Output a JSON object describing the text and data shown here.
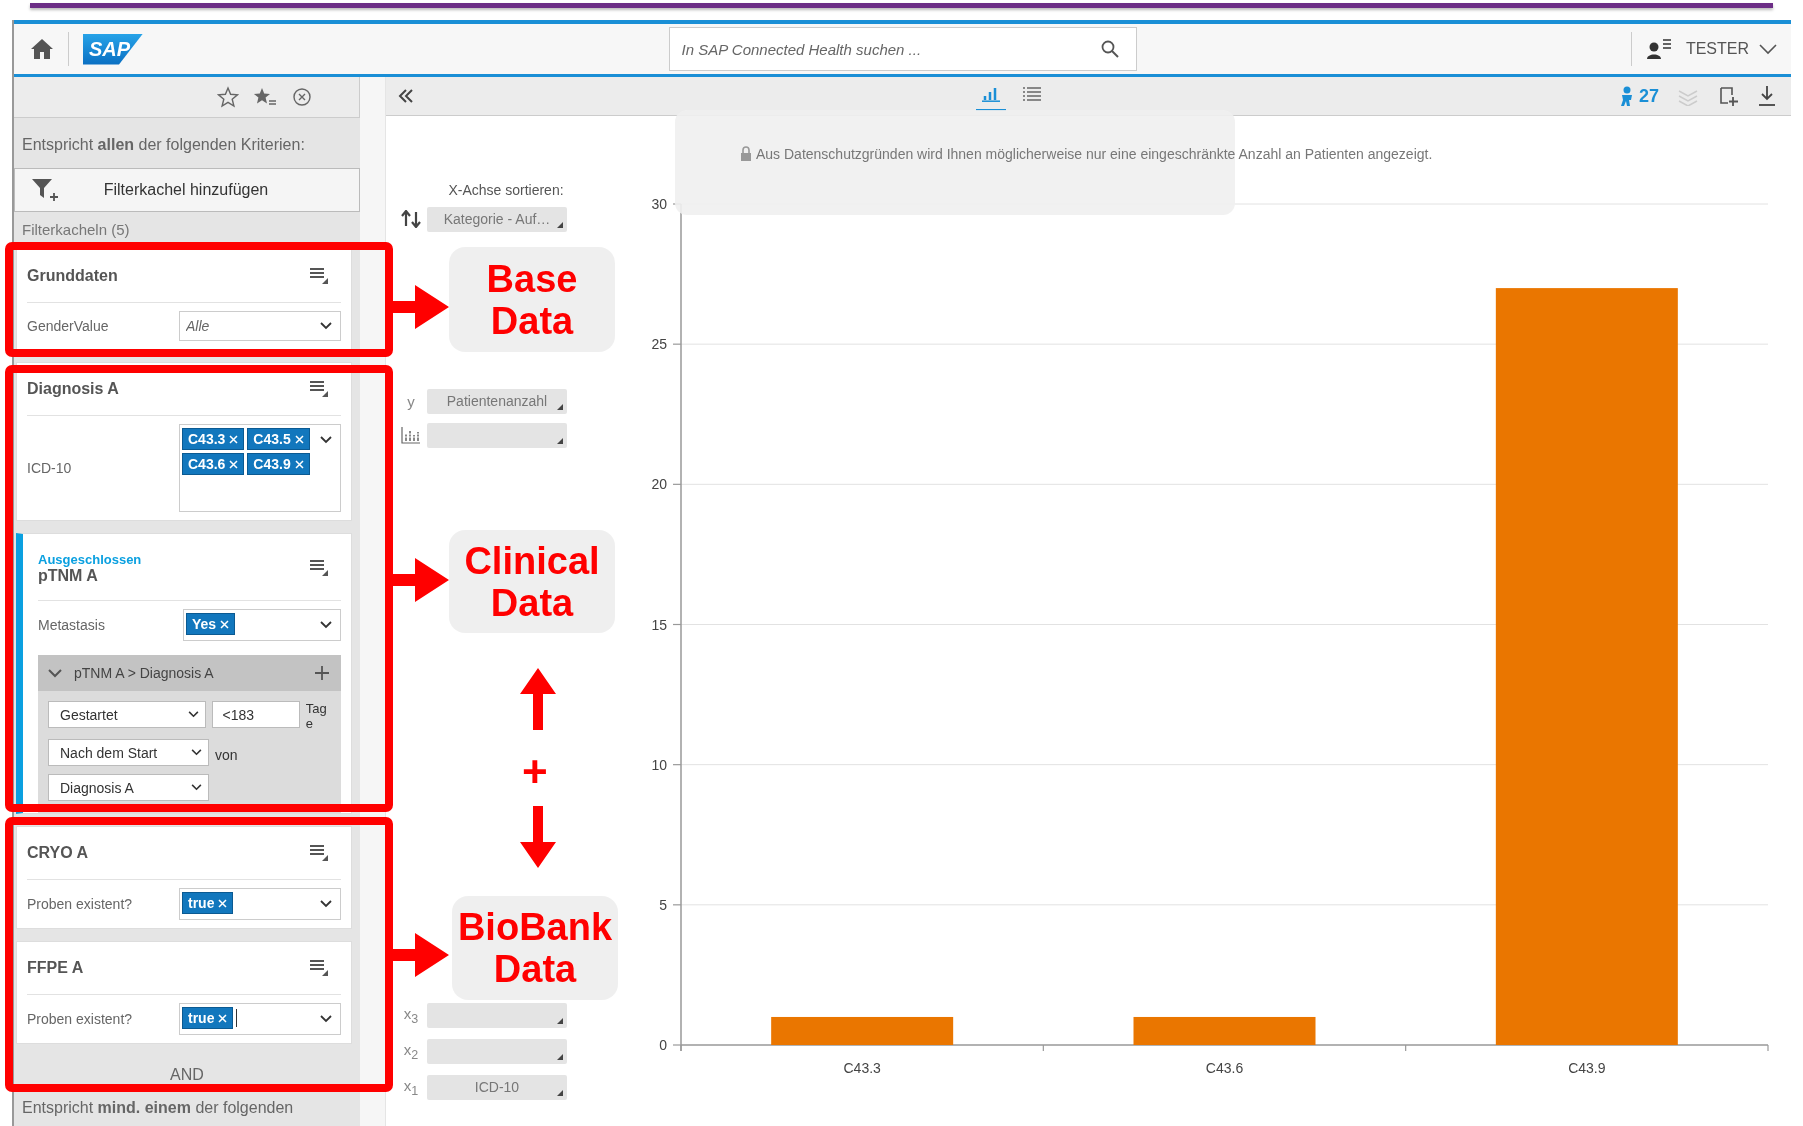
{
  "header": {
    "logo": "SAP",
    "search_placeholder": "In SAP Connected Health suchen ...",
    "user": "TESTER"
  },
  "filter_panel": {
    "match_all": "Entspricht **allen** der folgenden Kriterien:",
    "add_button": "Filterkachel hinzufügen",
    "count_label": "Filterkacheln (5)",
    "cards": [
      {
        "title": "Grunddaten",
        "excluded": false,
        "fields": [
          {
            "label": "GenderValue",
            "kind": "select",
            "placeholder": "Alle"
          }
        ]
      },
      {
        "title": "Diagnosis A",
        "excluded": false,
        "fields": [
          {
            "label": "ICD-10",
            "kind": "tags",
            "tags": [
              "C43.3",
              "C43.5",
              "C43.6",
              "C43.9"
            ],
            "focused": false
          }
        ]
      },
      {
        "title": "pTNM A",
        "excluded": true,
        "excluded_label": "Ausgeschlossen",
        "fields": [
          {
            "label": "Metastasis",
            "kind": "tags",
            "tags": [
              "Yes"
            ],
            "focused": false
          }
        ],
        "relation": {
          "title": "pTNM A > Diagnosis A",
          "expanded": true,
          "timing": "Gestartet",
          "days": "<183",
          "days_unit": "Tage",
          "anchor": "Nach dem Start",
          "of_label": "von",
          "reference": "Diagnosis A"
        }
      },
      {
        "title": "CRYO A",
        "excluded": false,
        "fields": [
          {
            "label": "Proben existent?",
            "kind": "tags",
            "tags": [
              "true"
            ],
            "focused": false
          }
        ]
      },
      {
        "title": "FFPE A",
        "excluded": false,
        "fields": [
          {
            "label": "Proben existent?",
            "kind": "tags",
            "tags": [
              "true"
            ],
            "focused": true
          }
        ]
      }
    ],
    "and_label": "AND",
    "match_any": "Entspricht **mind. einem** der folgenden"
  },
  "toolbar": {
    "views": [
      {
        "kind": "chart",
        "selected": true
      },
      {
        "kind": "list",
        "selected": false
      }
    ],
    "patient_count": "27"
  },
  "notice": "Aus Datenschutzgründen wird Ihnen möglicherweise nur eine eingeschränkte Anzahl an Patienten angezeigt.",
  "axis_controls": {
    "sort_label": "X-Achse sortieren:",
    "sort_value": "Kategorie - Auf…",
    "axes": [
      {
        "kind": "y",
        "label": "y",
        "value": "Patientenanzahl"
      },
      {
        "kind": "stack"
      },
      {
        "kind": "x",
        "label": "x$_{3}$"
      },
      {
        "kind": "x",
        "label": "x$_{2}$"
      },
      {
        "kind": "x",
        "label": "x$_{1}$",
        "value": "ICD-10"
      }
    ]
  },
  "chart": {
    "chart_data": {
      "type": "bar",
      "categories": [
        "C43.3",
        "C43.6",
        "C43.9"
      ],
      "series": [
        {
          "color": "#ea7600",
          "values": [
            1,
            1,
            27
          ]
        }
      ],
      "ylim": [
        0,
        30
      ],
      "grid": true,
      "yticks": [
        0,
        5,
        10,
        15,
        20,
        25,
        30
      ]
    }
  },
  "annotations": {
    "callouts": [
      {
        "text": "Base Data"
      },
      {
        "text": "Clinical Data"
      },
      {
        "text": "BioBank Data"
      }
    ],
    "link_symbol": "+"
  }
}
